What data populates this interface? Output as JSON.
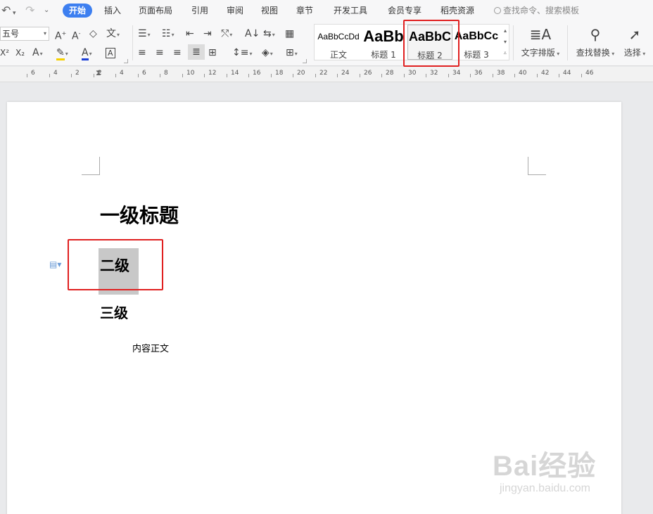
{
  "window": {
    "tabs": [
      "开始",
      "插入",
      "页面布局",
      "引用",
      "审阅",
      "视图",
      "章节",
      "开发工具",
      "会员专享",
      "稻壳资源"
    ],
    "active_tab": "开始",
    "search_placeholder": "查找命令、搜索模板"
  },
  "ribbon": {
    "font_size_value": "五号",
    "style_gallery": [
      {
        "preview": "AaBbCcDd",
        "name": "正文"
      },
      {
        "preview": "AaBb",
        "name": "标题 1"
      },
      {
        "preview": "AaBbC",
        "name": "标题 2"
      },
      {
        "preview": "AaBbCc",
        "name": "标题 3"
      }
    ],
    "selected_style": "标题 2",
    "text_layout_label": "文字排版",
    "find_replace_label": "查找替换",
    "select_label": "选择"
  },
  "ruler": {
    "numbers": [
      "6",
      "4",
      "2",
      "2",
      "4",
      "6",
      "8",
      "10",
      "12",
      "14",
      "16",
      "18",
      "20",
      "22",
      "24",
      "26",
      "28",
      "30",
      "32",
      "34",
      "36",
      "38",
      "40",
      "42",
      "44",
      "46"
    ]
  },
  "document": {
    "heading1": "一级标题",
    "heading2": "二级",
    "heading3": "三级",
    "body": "内容正文"
  },
  "watermark": {
    "brand": "Bai经验",
    "url": "jingyan.baidu.com"
  },
  "colors": {
    "accent": "#3d7ff0",
    "highlight_box": "#e02020",
    "selection": "#c8c8c8"
  }
}
